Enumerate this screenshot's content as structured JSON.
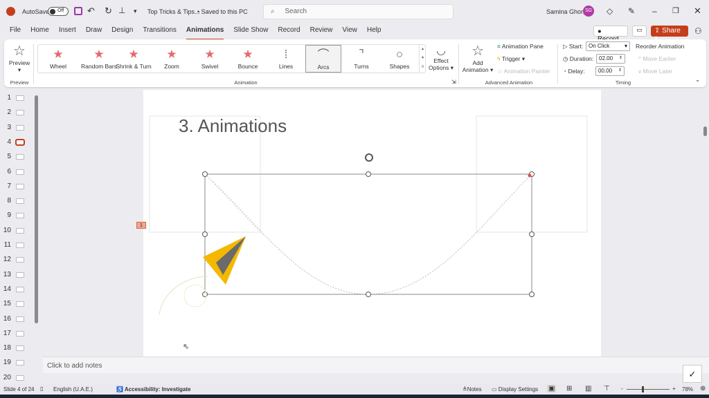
{
  "titlebar": {
    "autosave": "AutoSave",
    "toggle": "Off",
    "doc_title": "Top Tricks & Tips...",
    "saved": "• Saved to this PC",
    "search_placeholder": "Search",
    "user": "Samina Ghori",
    "initials": "SG",
    "avatar_color": "#b13aa6"
  },
  "tabs": [
    "File",
    "Home",
    "Insert",
    "Draw",
    "Design",
    "Transitions",
    "Animations",
    "Slide Show",
    "Record",
    "Review",
    "View",
    "Help"
  ],
  "active_tab": "Animations",
  "actions": {
    "record": "Record",
    "share": "Share",
    "accent": "#c43e1c"
  },
  "ribbon": {
    "preview": {
      "label": "Preview",
      "group": "Preview"
    },
    "gallery": [
      "Wheel",
      "Random Bars",
      "Shrink & Turn",
      "Zoom",
      "Swivel",
      "Bounce",
      "Lines",
      "Arcs",
      "Turns",
      "Shapes"
    ],
    "selected_effect": "Arcs",
    "effect_options": [
      "Effect",
      "Options"
    ],
    "animation_group": "Animation",
    "add_animation": [
      "Add",
      "Animation"
    ],
    "animation_pane": "Animation Pane",
    "trigger": "Trigger",
    "animation_painter": "Animation Painter",
    "advanced_group": "Advanced Animation",
    "start_label": "Start:",
    "start_value": "On Click",
    "duration_label": "Duration:",
    "duration_value": "02.00",
    "delay_label": "Delay:",
    "delay_value": "00.00",
    "reorder": "Reorder Animation",
    "move_earlier": "Move Earlier",
    "move_later": "Move Later",
    "timing_group": "Timing"
  },
  "thumbnails": [
    "1",
    "2",
    "3",
    "4",
    "5",
    "6",
    "7",
    "8",
    "9",
    "10",
    "11",
    "12",
    "13",
    "14",
    "15",
    "16",
    "17",
    "18",
    "19",
    "20"
  ],
  "current_slide": "4",
  "slide": {
    "title": "3. Animations",
    "anim_tag": "1"
  },
  "notes_placeholder": "Click to add notes",
  "status": {
    "slide": "Slide 4 of 24",
    "language": "English (U.A.E.)",
    "accessibility": "Accessibility: Investigate",
    "notes": "Notes",
    "display": "Display Settings",
    "zoom": "78%"
  }
}
